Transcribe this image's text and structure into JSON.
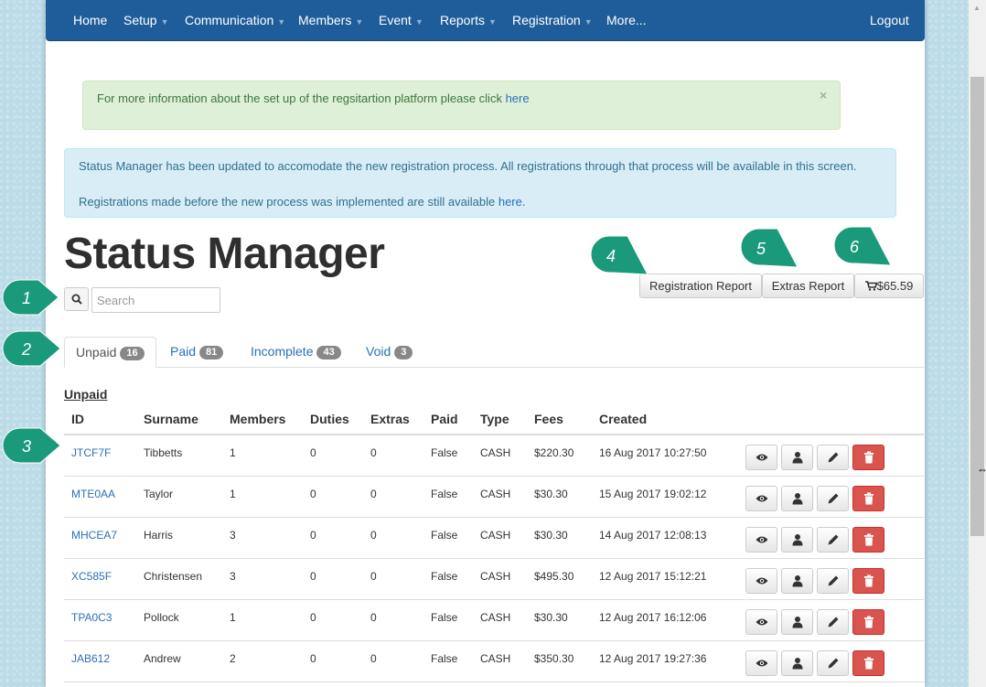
{
  "navbar": {
    "items": [
      {
        "label": "Home",
        "dropdown": false
      },
      {
        "label": "Setup",
        "dropdown": true
      },
      {
        "label": "Communication",
        "dropdown": true
      },
      {
        "label": "Members",
        "dropdown": true
      },
      {
        "label": "Event",
        "dropdown": true
      },
      {
        "label": "Reports",
        "dropdown": true
      },
      {
        "label": "Registration",
        "dropdown": true
      },
      {
        "label": "More...",
        "dropdown": false
      }
    ],
    "logout": "Logout"
  },
  "alert_info": {
    "text": "For more information about the set up of the regsitartion platform please click ",
    "link": "here",
    "close": "×"
  },
  "alert_status": {
    "line1": "Status Manager has been updated to accomodate the new registration process. All registrations through that process will be available in this screen.",
    "line2": "Registrations made before the new process was implemented are still available ",
    "line2_link": "here",
    "line2_end": "."
  },
  "page_title": "Status Manager",
  "search": {
    "placeholder": "Search"
  },
  "toolbar": {
    "registration_report": "Registration Report",
    "extras_report": "Extras Report",
    "cart_total": "$65.59"
  },
  "tabs": [
    {
      "label": "Unpaid",
      "count": "16",
      "active": true
    },
    {
      "label": "Paid",
      "count": "81",
      "active": false
    },
    {
      "label": "Incomplete",
      "count": "43",
      "active": false
    },
    {
      "label": "Void",
      "count": "3",
      "active": false
    }
  ],
  "section_title": "Unpaid",
  "table": {
    "columns": [
      "ID",
      "Surname",
      "Members",
      "Duties",
      "Extras",
      "Paid",
      "Type",
      "Fees",
      "Created"
    ],
    "rows": [
      [
        "JTCF7F",
        "Tibbetts",
        "1",
        "0",
        "0",
        "False",
        "CASH",
        "$220.30",
        "16 Aug 2017 10:27:50"
      ],
      [
        "MTE0AA",
        "Taylor",
        "1",
        "0",
        "0",
        "False",
        "CASH",
        "$30.30",
        "15 Aug 2017 19:02:12"
      ],
      [
        "MHCEA7",
        "Harris",
        "3",
        "0",
        "0",
        "False",
        "CASH",
        "$30.30",
        "14 Aug 2017 12:08:13"
      ],
      [
        "XC585F",
        "Christensen",
        "3",
        "0",
        "0",
        "False",
        "CASH",
        "$495.30",
        "12 Aug 2017 15:12:21"
      ],
      [
        "TPA0C3",
        "Pollock",
        "1",
        "0",
        "0",
        "False",
        "CASH",
        "$30.30",
        "12 Aug 2017 16:12:06"
      ],
      [
        "JAB612",
        "Andrew",
        "2",
        "0",
        "0",
        "False",
        "CASH",
        "$350.30",
        "12 Aug 2017 19:27:36"
      ]
    ]
  },
  "callouts": [
    "1",
    "2",
    "3",
    "4",
    "5",
    "6"
  ],
  "colors": {
    "navbar": "#1f5d9a",
    "link": "#2a6fb8",
    "callout": "#1a9a7a",
    "delete": "#d9534f",
    "badge": "#888888"
  }
}
